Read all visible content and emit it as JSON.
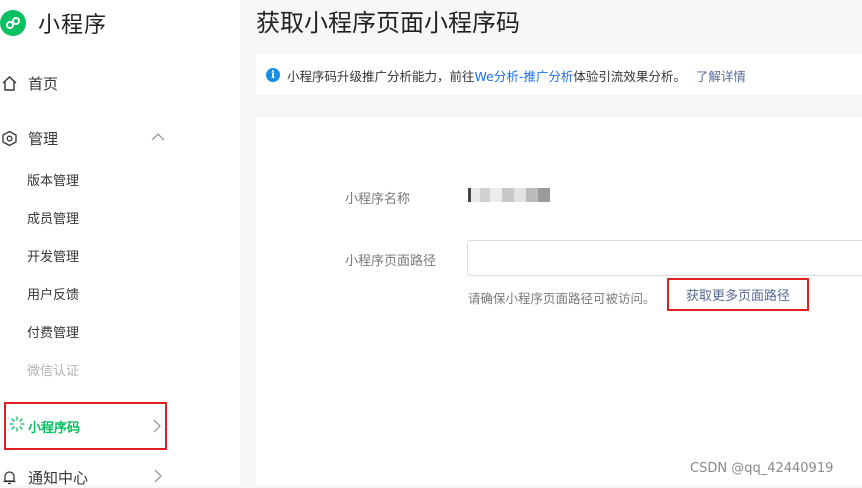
{
  "app": {
    "title": "小程序",
    "brand_color": "#07c160"
  },
  "sidebar": {
    "home": {
      "label": "首页",
      "icon": "home-icon"
    },
    "manage": {
      "label": "管理",
      "icon": "manage-icon",
      "expanded": true,
      "items": [
        {
          "label": "版本管理",
          "enabled": true
        },
        {
          "label": "成员管理",
          "enabled": true
        },
        {
          "label": "开发管理",
          "enabled": true
        },
        {
          "label": "用户反馈",
          "enabled": true
        },
        {
          "label": "付费管理",
          "enabled": true
        },
        {
          "label": "微信认证",
          "enabled": false
        }
      ]
    },
    "qrcode": {
      "label": "小程序码",
      "icon": "qrcode-icon",
      "active": true
    },
    "notifications": {
      "label": "通知中心",
      "icon": "bell-icon"
    }
  },
  "main": {
    "page_title": "获取小程序页面小程序码",
    "notice": {
      "text_before": "小程序码升级推广分析能力，前往",
      "we_link": "We分析-推广分析",
      "text_after": "体验引流效果分析。",
      "learn_more": "了解详情"
    },
    "form": {
      "name_label": "小程序名称",
      "path_label": "小程序页面路径",
      "path_value": "",
      "hint": "请确保小程序页面路径可被访问。",
      "more_paths_link": "获取更多页面路径"
    }
  },
  "watermark": "CSDN @qq_42440919",
  "colors": {
    "link": "#576b95",
    "highlight_border": "#e0201f",
    "active_green": "#07c160"
  }
}
